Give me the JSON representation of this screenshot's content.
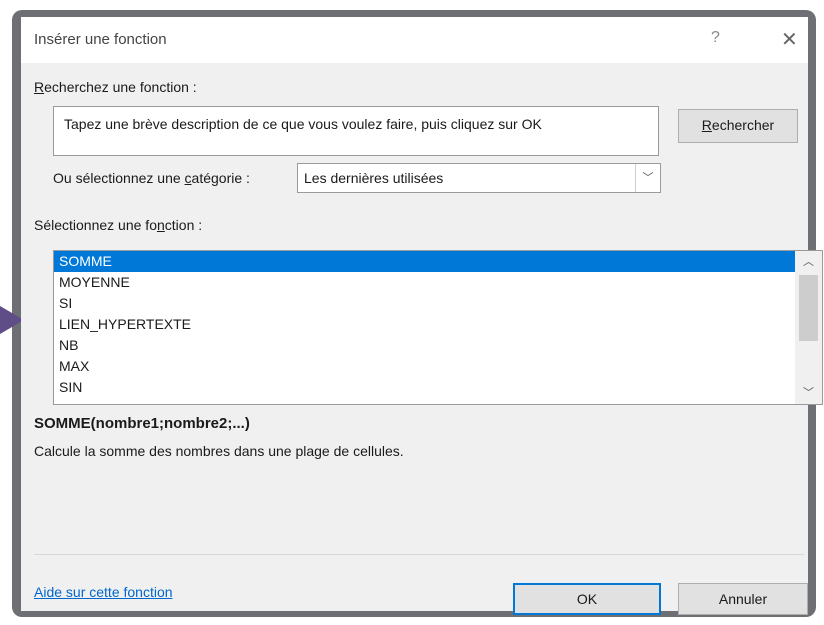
{
  "dialog": {
    "title": "Insérer une fonction",
    "help_glyph": "?",
    "close_glyph": "✕"
  },
  "search": {
    "label_accel": "R",
    "label_rest": "echerchez une fonction :",
    "input_value": "Tapez une brève description de ce que vous voulez faire, puis cliquez sur OK",
    "button_accel": "R",
    "button_rest": "echercher"
  },
  "category": {
    "label_pre": "Ou sélectionnez une ",
    "label_accel": "c",
    "label_post": "atégorie :",
    "selected": "Les dernières utilisées"
  },
  "function_list": {
    "label_pre": "Sélectionnez une fo",
    "label_accel": "n",
    "label_post": "ction :",
    "items": [
      "SOMME",
      "MOYENNE",
      "SI",
      "LIEN_HYPERTEXTE",
      "NB",
      "MAX",
      "SIN"
    ],
    "selected_index": 0
  },
  "details": {
    "syntax": "SOMME(nombre1;nombre2;...)",
    "description": "Calcule la somme des nombres dans une plage de cellules."
  },
  "footer": {
    "help_link": "Aide sur cette fonction",
    "ok_label": "OK",
    "cancel_label": "Annuler"
  },
  "icons": {
    "chevron_down": "chevron-down-icon",
    "chevron_up": "chevron-up-icon"
  },
  "colors": {
    "accent": "#0078d7",
    "frame": "#6e6f74",
    "pointer_arrow": "#5f4d87",
    "link": "#0066cc"
  }
}
